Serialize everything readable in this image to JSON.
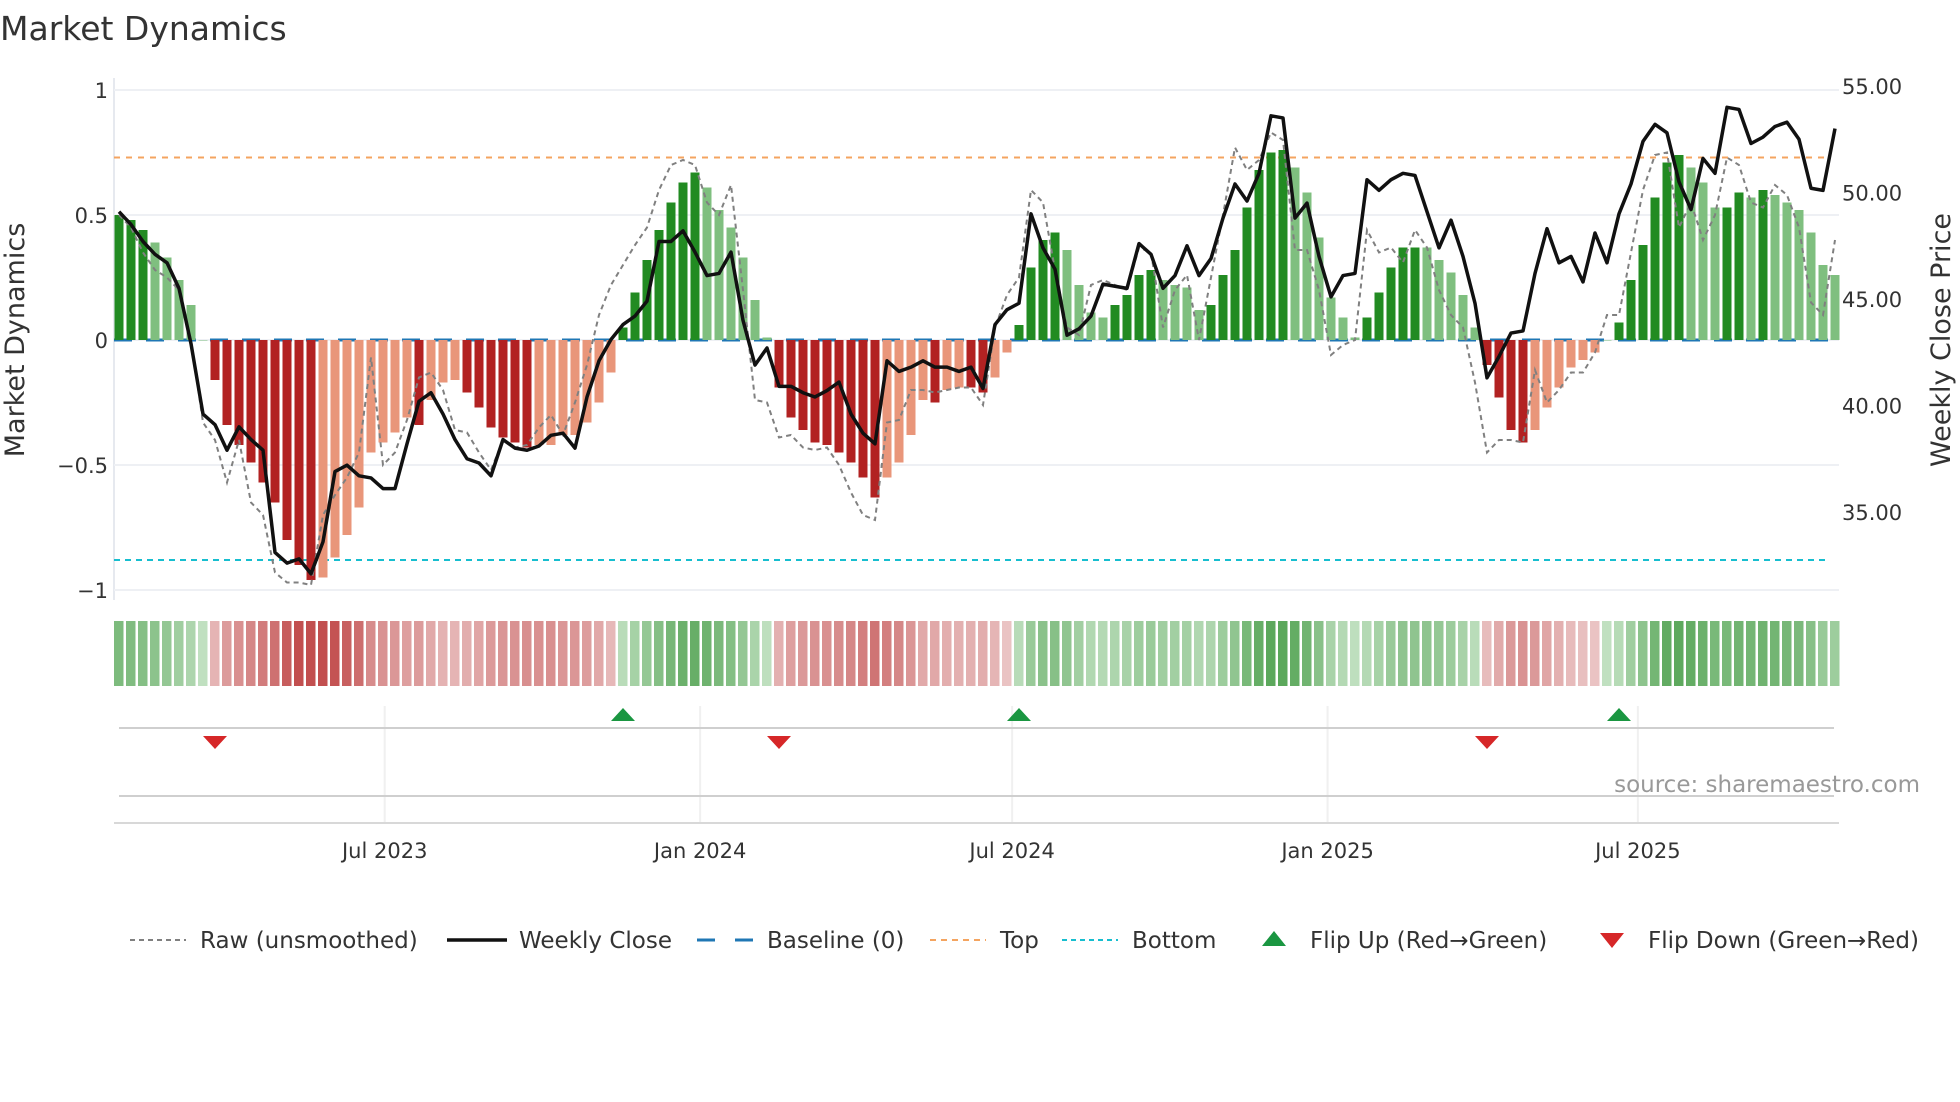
{
  "chart_data": {
    "type": "bar",
    "title": "Market Dynamics",
    "ylabel": "Market Dynamics",
    "y2label": "Weekly Close Price",
    "ylim": [
      -1.05,
      1.05
    ],
    "y2lim": [
      32.2,
      55.4
    ],
    "yticks": [
      {
        "value": 1,
        "label": "1"
      },
      {
        "value": 0.5,
        "label": "0.5"
      },
      {
        "value": 0,
        "label": "0"
      },
      {
        "value": -0.5,
        "label": "−0.5"
      },
      {
        "value": -1,
        "label": "−1"
      }
    ],
    "y2ticks": [
      {
        "value": 55,
        "label": "55.00"
      },
      {
        "value": 50,
        "label": "50.00"
      },
      {
        "value": 45,
        "label": "45.00"
      },
      {
        "value": 40,
        "label": "40.00"
      },
      {
        "value": 35,
        "label": "35.00"
      }
    ],
    "start_date": "2023-01-27",
    "frequency": "weekly",
    "xticks": [
      {
        "date": "2023-07-01",
        "label": "Jul 2023"
      },
      {
        "date": "2024-01-01",
        "label": "Jan 2024"
      },
      {
        "date": "2024-07-01",
        "label": "Jul 2024"
      },
      {
        "date": "2025-01-01",
        "label": "Jan 2025"
      },
      {
        "date": "2025-07-01",
        "label": "Jul 2025"
      }
    ],
    "top_level": 0.73,
    "bottom_level": -0.88,
    "baseline": 0,
    "values": [
      0.5,
      0.48,
      0.44,
      0.39,
      0.33,
      0.24,
      0.14,
      0,
      -0.16,
      -0.34,
      -0.42,
      -0.49,
      -0.57,
      -0.65,
      -0.8,
      -0.9,
      -0.96,
      -0.95,
      -0.87,
      -0.78,
      -0.67,
      -0.45,
      -0.41,
      -0.37,
      -0.31,
      -0.34,
      -0.24,
      -0.17,
      -0.16,
      -0.21,
      -0.27,
      -0.35,
      -0.39,
      -0.41,
      -0.43,
      -0.42,
      -0.42,
      -0.38,
      -0.38,
      -0.33,
      -0.25,
      -0.13,
      0.05,
      0.19,
      0.32,
      0.44,
      0.55,
      0.63,
      0.67,
      0.61,
      0.52,
      0.45,
      0.33,
      0.16,
      0.01,
      -0.19,
      -0.31,
      -0.36,
      -0.41,
      -0.42,
      -0.45,
      -0.49,
      -0.55,
      -0.63,
      -0.55,
      -0.49,
      -0.38,
      -0.24,
      -0.25,
      -0.2,
      -0.19,
      -0.19,
      -0.21,
      -0.15,
      -0.05,
      0.06,
      0.29,
      0.4,
      0.43,
      0.36,
      0.22,
      0.11,
      0.09,
      0.14,
      0.18,
      0.26,
      0.28,
      0.24,
      0.22,
      0.21,
      0.12,
      0.14,
      0.26,
      0.36,
      0.53,
      0.68,
      0.75,
      0.76,
      0.69,
      0.59,
      0.41,
      0.17,
      0.09,
      0.01,
      0.09,
      0.19,
      0.29,
      0.37,
      0.37,
      0.37,
      0.32,
      0.27,
      0.18,
      0.05,
      -0.1,
      -0.23,
      -0.36,
      -0.41,
      -0.36,
      -0.27,
      -0.19,
      -0.11,
      -0.08,
      -0.05,
      0,
      0.07,
      0.24,
      0.38,
      0.57,
      0.71,
      0.74,
      0.69,
      0.63,
      0.53,
      0.53,
      0.59,
      0.57,
      0.6,
      0.58,
      0.55,
      0.52,
      0.43,
      0.3,
      0.26
    ],
    "strength": "SSSWWWWWSSSSSSSSSWWWWWWWWSWWWSSSSSSWWWWWWWSSSSSSSWWWWWWSSSSSSSSSWWWWSWWSSWWSSSSWWWWSSSSWWWWSSSSSSSWWWWWWSSSSSWWWWWSSSSWWWWWWWSSSSSSWWWSSWSWWWWWW",
    "raw": [
      0.5,
      0.45,
      0.35,
      0.28,
      0.25,
      0.2,
      0.0,
      -0.33,
      -0.4,
      -0.57,
      -0.4,
      -0.65,
      -0.7,
      -0.93,
      -0.97,
      -0.97,
      -0.98,
      -0.7,
      -0.62,
      -0.55,
      -0.45,
      -0.07,
      -0.5,
      -0.45,
      -0.32,
      -0.15,
      -0.13,
      -0.2,
      -0.36,
      -0.37,
      -0.45,
      -0.52,
      -0.4,
      -0.43,
      -0.42,
      -0.35,
      -0.3,
      -0.38,
      -0.25,
      -0.1,
      0.1,
      0.22,
      0.3,
      0.38,
      0.45,
      0.6,
      0.7,
      0.72,
      0.7,
      0.55,
      0.5,
      0.62,
      0.2,
      -0.24,
      -0.25,
      -0.39,
      -0.38,
      -0.43,
      -0.44,
      -0.43,
      -0.5,
      -0.61,
      -0.7,
      -0.72,
      -0.33,
      -0.32,
      -0.2,
      -0.2,
      -0.21,
      -0.2,
      -0.19,
      -0.19,
      -0.26,
      0.05,
      0.18,
      0.25,
      0.6,
      0.55,
      0.28,
      0.05,
      0.02,
      0.22,
      0.24,
      0.22,
      0.2,
      0.37,
      0.35,
      0.05,
      0.2,
      0.26,
      0.0,
      0.25,
      0.5,
      0.77,
      0.68,
      0.72,
      0.83,
      0.8,
      0.36,
      0.36,
      0.2,
      -0.06,
      -0.02,
      0.0,
      0.44,
      0.35,
      0.37,
      0.31,
      0.44,
      0.37,
      0.2,
      0.1,
      0.05,
      -0.17,
      -0.45,
      -0.4,
      -0.4,
      -0.41,
      -0.12,
      -0.25,
      -0.2,
      -0.13,
      -0.13,
      -0.05,
      0.1,
      0.1,
      0.35,
      0.6,
      0.74,
      0.75,
      0.45,
      0.55,
      0.4,
      0.5,
      0.73,
      0.7,
      0.55,
      0.53,
      0.62,
      0.58,
      0.45,
      0.15,
      0.1,
      0.4
    ],
    "close": [
      49.1,
      48.5,
      47.7,
      47.1,
      46.7,
      45.5,
      42.9,
      39.6,
      39.1,
      37.9,
      39.0,
      38.4,
      37.9,
      33.1,
      32.6,
      32.8,
      32.1,
      33.6,
      36.9,
      37.2,
      36.7,
      36.6,
      36.1,
      36.1,
      38.2,
      40.2,
      40.6,
      39.6,
      38.4,
      37.5,
      37.3,
      36.7,
      38.4,
      38.0,
      37.9,
      38.1,
      38.6,
      38.7,
      38.0,
      40.4,
      42.1,
      43.1,
      43.8,
      44.2,
      44.9,
      47.7,
      47.7,
      48.2,
      47.2,
      46.1,
      46.2,
      47.2,
      44.0,
      41.9,
      42.7,
      40.9,
      40.9,
      40.6,
      40.4,
      40.7,
      41.1,
      39.6,
      38.7,
      38.2,
      42.1,
      41.6,
      41.8,
      42.1,
      41.8,
      41.8,
      41.6,
      41.8,
      40.8,
      43.8,
      44.5,
      44.8,
      49.0,
      47.4,
      46.4,
      43.3,
      43.6,
      44.2,
      45.7,
      45.6,
      45.5,
      47.6,
      47.1,
      45.5,
      46.1,
      47.5,
      46.1,
      46.9,
      48.8,
      50.4,
      49.6,
      50.9,
      53.6,
      53.5,
      48.8,
      49.5,
      47.0,
      45.1,
      46.1,
      46.2,
      50.6,
      50.1,
      50.6,
      50.9,
      50.8,
      49.1,
      47.4,
      48.7,
      47.0,
      44.8,
      41.3,
      42.3,
      43.4,
      43.5,
      46.2,
      48.3,
      46.7,
      47.0,
      45.8,
      48.1,
      46.7,
      49.0,
      50.4,
      52.4,
      53.2,
      52.8,
      50.5,
      49.2,
      51.6,
      50.9,
      54.0,
      53.9,
      52.3,
      52.6,
      53.1,
      53.3,
      52.5,
      50.2,
      50.1,
      53.0
    ],
    "flip_up_weeks": [
      42,
      75,
      125
    ],
    "flip_down_weeks": [
      8,
      55,
      114
    ],
    "legend": [
      {
        "key": "raw",
        "label": "Raw (unsmoothed)"
      },
      {
        "key": "close",
        "label": "Weekly Close"
      },
      {
        "key": "baseline",
        "label": "Baseline (0)"
      },
      {
        "key": "top",
        "label": "Top"
      },
      {
        "key": "bottom",
        "label": "Bottom"
      },
      {
        "key": "flip_up",
        "label": "Flip Up (Red→Green)"
      },
      {
        "key": "flip_down",
        "label": "Flip Down (Green→Red)"
      }
    ],
    "legend_placement": "bottom",
    "colors": {
      "pos_strong": "#228b22",
      "pos_weak": "#7fbf7f",
      "neg_strong": "#b22222",
      "neg_weak": "#e9967a",
      "raw": "#808080",
      "close": "#111111",
      "baseline": "#1f77b4",
      "top": "#f4a460",
      "bottom": "#17becf",
      "flip_up": "#1a9641",
      "flip_down": "#d62728"
    }
  },
  "source": "source: sharemaestro.com"
}
